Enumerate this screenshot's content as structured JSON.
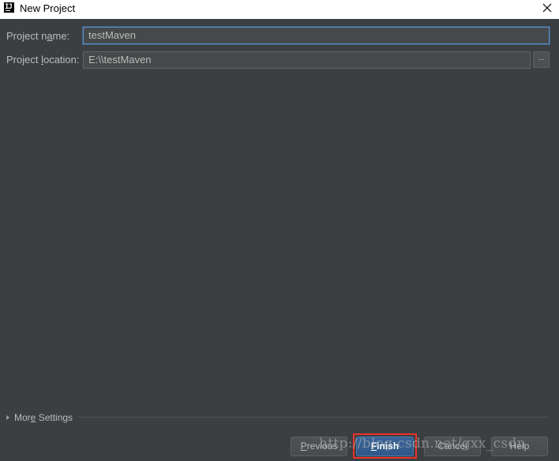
{
  "window": {
    "title": "New Project",
    "app_icon_text": "IJ"
  },
  "form": {
    "name_label_pre": "Project n",
    "name_label_mnemonic": "a",
    "name_label_post": "me:",
    "name_value": "testMaven",
    "location_label_pre": "Project ",
    "location_label_mnemonic": "l",
    "location_label_post": "ocation:",
    "location_value": "E:\\\\testMaven",
    "browse_label": "..."
  },
  "more_settings": {
    "label_pre": "Mor",
    "label_mnemonic": "e",
    "label_post": " Settings"
  },
  "buttons": {
    "previous_mnemonic": "P",
    "previous_rest": "revious",
    "finish_mnemonic": "F",
    "finish_rest": "inish",
    "cancel_label": "Cancel",
    "help_label": "Help"
  },
  "watermark": "http://blog.csdn.net/gxx_csdn",
  "colors": {
    "background": "#3c3f41",
    "field_background": "#45494a",
    "focus_border": "#5f8fc8",
    "default_button": "#365880",
    "highlight": "#e8322c"
  }
}
